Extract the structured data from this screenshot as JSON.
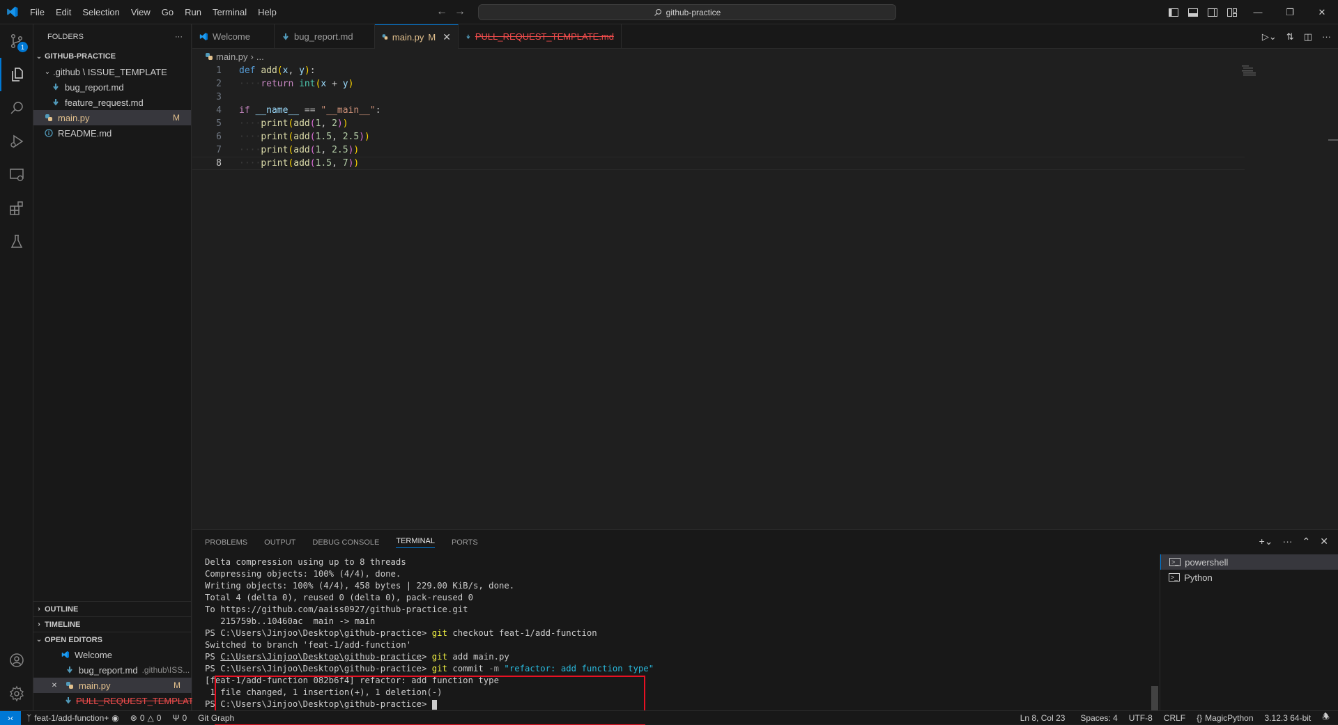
{
  "titlebar": {
    "menu": [
      "File",
      "Edit",
      "Selection",
      "View",
      "Go",
      "Run",
      "Terminal",
      "Help"
    ],
    "search": "github-practice",
    "accent": "#0078d4"
  },
  "activity": {
    "scm_badge": "1"
  },
  "sidebar": {
    "header": "FOLDERS",
    "root": "GITHUB-PRACTICE",
    "folder": ".github \\ ISSUE_TEMPLATE",
    "files": {
      "bug_report": "bug_report.md",
      "feature_request": "feature_request.md",
      "main": "main.py",
      "main_badge": "M",
      "readme": "README.md"
    },
    "outline": "OUTLINE",
    "timeline": "TIMELINE",
    "open_editors": "OPEN EDITORS",
    "open": {
      "welcome": "Welcome",
      "bug_report": "bug_report.md",
      "bug_report_path": ".github\\ISS...",
      "main": "main.py",
      "main_badge": "M",
      "pr_template": "PULL_REQUEST_TEMPLATE..."
    }
  },
  "tabs": {
    "welcome": "Welcome",
    "bug_report": "bug_report.md",
    "main": "main.py",
    "main_badge": "M",
    "pr_template": "PULL_REQUEST_TEMPLATE.md"
  },
  "breadcrumb": {
    "file": "main.py",
    "rest": "..."
  },
  "editor": {
    "current_line": 8,
    "lines": [
      "1",
      "2",
      "3",
      "4",
      "5",
      "6",
      "7",
      "8"
    ]
  },
  "panel": {
    "tabs": [
      "PROBLEMS",
      "OUTPUT",
      "DEBUG CONSOLE",
      "TERMINAL",
      "PORTS"
    ],
    "active_tab": "TERMINAL",
    "terminal_lines": {
      "l1": "Delta compression using up to 8 threads",
      "l2": "Compressing objects: 100% (4/4), done.",
      "l3": "Writing objects: 100% (4/4), 458 bytes | 229.00 KiB/s, done.",
      "l4": "Total 4 (delta 0), reused 0 (delta 0), pack-reused 0",
      "l5": "To https://github.com/aaiss0927/github-practice.git",
      "l6": "   215759b..10460ac  main -> main",
      "prompt": "PS C:\\Users\\Jinjoo\\Desktop\\github-practice> ",
      "prompt_path": "C:\\Users\\Jinjoo\\Desktop\\github-practice",
      "cmd1_a": "git",
      "cmd1_b": " checkout feat-1/add-function",
      "l8": "Switched to branch 'feat-1/add-function'",
      "cmd2_a": "git",
      "cmd2_b": " add main.py",
      "cmd3_a": "git",
      "cmd3_b": " commit ",
      "cmd3_flag": "-m",
      "cmd3_msg": " \"refactor: add function type\"",
      "l11": "[feat-1/add-function 082b6f4] refactor: add function type",
      "l12": " 1 file changed, 1 insertion(+), 1 deletion(-)"
    },
    "terminals": [
      "powershell",
      "Python"
    ]
  },
  "statusbar": {
    "branch": "feat-1/add-function+",
    "errors": "0",
    "warnings": "0",
    "ports": "0",
    "git_graph": "Git Graph",
    "position": "Ln 8, Col 23",
    "spaces": "Spaces: 4",
    "encoding": "UTF-8",
    "eol": "CRLF",
    "language": "MagicPython",
    "interpreter": "3.12.3 64-bit"
  }
}
